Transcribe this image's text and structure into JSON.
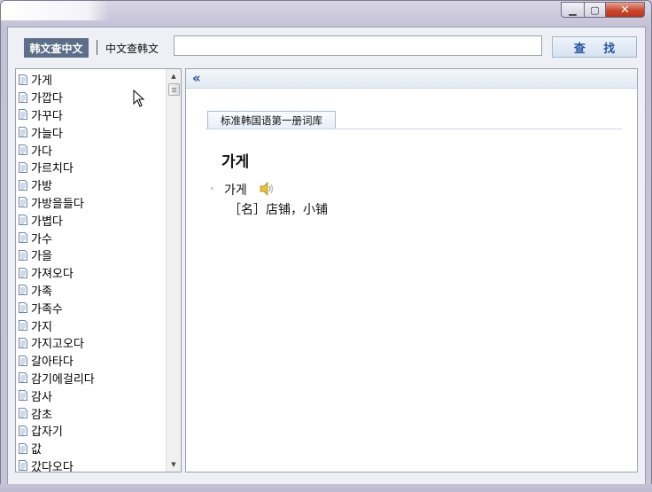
{
  "toolbar": {
    "mode_korean_to_chinese": "韩文查中文",
    "mode_chinese_to_korean": "中文查韩文",
    "search_value": "",
    "search_button": "查 找"
  },
  "word_list": [
    "가게",
    "가깝다",
    "가꾸다",
    "가늘다",
    "가다",
    "가르치다",
    "가방",
    "가방을들다",
    "가볍다",
    "가수",
    "가을",
    "가져오다",
    "가족",
    "가족수",
    "가지",
    "가지고오다",
    "갈아타다",
    "감기에걸리다",
    "감사",
    "감초",
    "갑자기",
    "값",
    "갔다오다"
  ],
  "detail": {
    "collapse_label": "«",
    "dictionary_tab": "标准韩国语第一册词库",
    "headword": "가게",
    "entry_bullet": "◦",
    "entry_word": "가게",
    "entry_definition": "［名］店铺，小铺"
  },
  "colors": {
    "active_mode_bg": "#5d6f88",
    "search_button_text": "#2a55a0",
    "close_button": "#c9472f"
  },
  "icons": {
    "list_item": "document-icon",
    "pronounce": "speaker-icon",
    "collapse": "double-chevron-left-icon"
  }
}
